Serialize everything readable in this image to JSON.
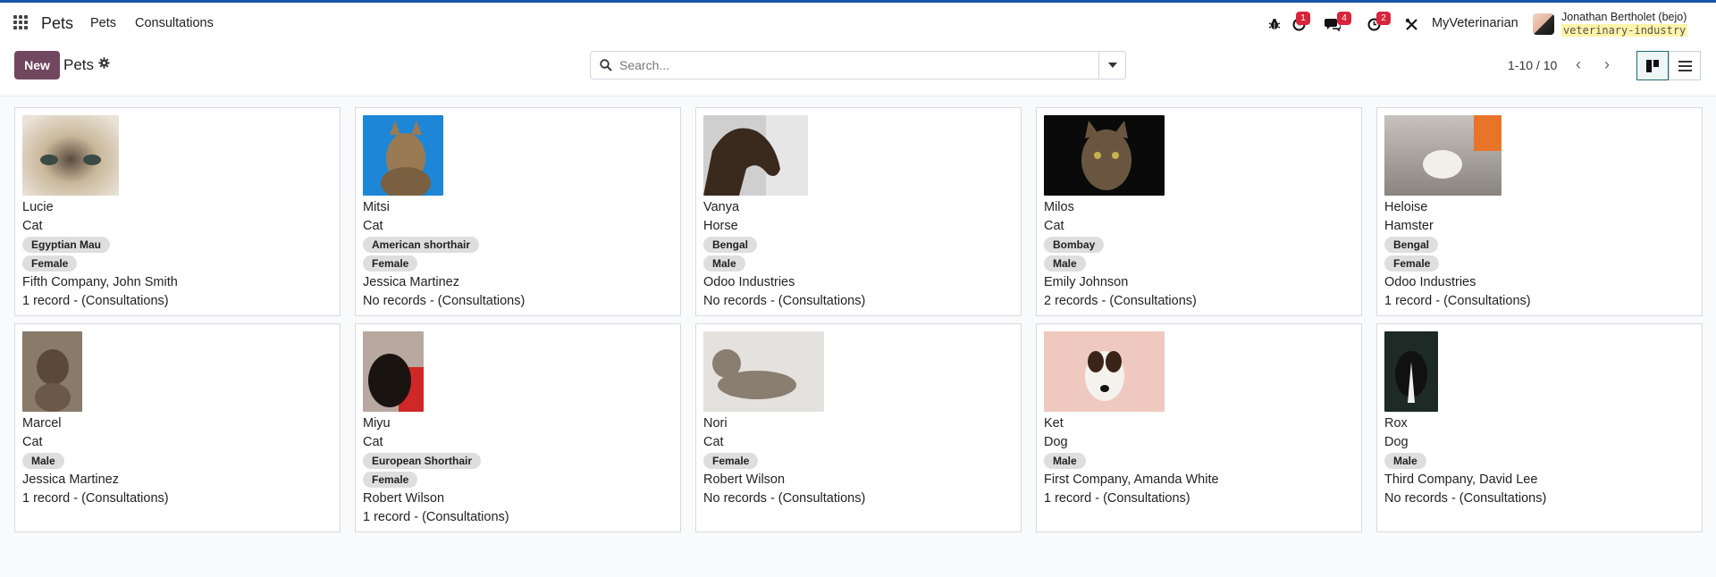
{
  "navbar": {
    "brand": "Pets",
    "menu": [
      "Pets",
      "Consultations"
    ],
    "badges": {
      "activity": "1",
      "messages": "4",
      "clock": "2"
    },
    "company": "MyVeterinarian",
    "user_name": "Jonathan Bertholet (bejo)",
    "user_db": "veterinary-industry"
  },
  "control_panel": {
    "new_label": "New",
    "title": "Pets",
    "search_placeholder": "Search...",
    "pager": "1-10 / 10"
  },
  "pets": [
    {
      "name": "Lucie",
      "type": "Cat",
      "tags": [
        "Egyptian Mau",
        "Female"
      ],
      "owner": "Fifth Company, John Smith",
      "consultations": "1 record - (Consultations)"
    },
    {
      "name": "Mitsi",
      "type": "Cat",
      "tags": [
        "American shorthair",
        "Female"
      ],
      "owner": "Jessica Martinez",
      "consultations": "No records - (Consultations)"
    },
    {
      "name": "Vanya",
      "type": "Horse",
      "tags": [
        "Bengal",
        "Male"
      ],
      "owner": "Odoo Industries",
      "consultations": "No records - (Consultations)"
    },
    {
      "name": "Milos",
      "type": "Cat",
      "tags": [
        "Bombay",
        "Male"
      ],
      "owner": "Emily Johnson",
      "consultations": "2 records - (Consultations)"
    },
    {
      "name": "Heloise",
      "type": "Hamster",
      "tags": [
        "Bengal",
        "Female"
      ],
      "owner": "Odoo Industries",
      "consultations": "1 record - (Consultations)"
    },
    {
      "name": "Marcel",
      "type": "Cat",
      "tags": [
        "Male"
      ],
      "owner": "Jessica Martinez",
      "consultations": "1 record - (Consultations)"
    },
    {
      "name": "Miyu",
      "type": "Cat",
      "tags": [
        "European Shorthair",
        "Female"
      ],
      "owner": "Robert Wilson",
      "consultations": "1 record - (Consultations)"
    },
    {
      "name": "Nori",
      "type": "Cat",
      "tags": [
        "Female"
      ],
      "owner": "Robert Wilson",
      "consultations": "No records - (Consultations)"
    },
    {
      "name": "Ket",
      "type": "Dog",
      "tags": [
        "Male"
      ],
      "owner": "First Company, Amanda White",
      "consultations": "1 record - (Consultations)"
    },
    {
      "name": "Rox",
      "type": "Dog",
      "tags": [
        "Male"
      ],
      "owner": "Third Company, David Lee",
      "consultations": "No records - (Consultations)"
    }
  ],
  "colors": {
    "primary": "#71465f",
    "topline": "#1a56a8",
    "badge": "#d9243b",
    "tag_bg": "#dedede"
  }
}
